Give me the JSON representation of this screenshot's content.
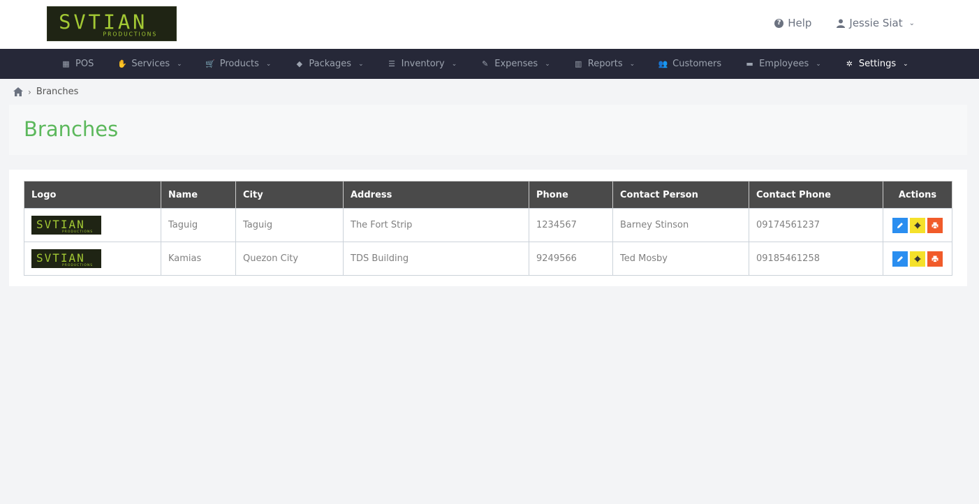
{
  "brand": {
    "logo_text": "SVTIAN",
    "logo_sub": "PRODUCTIONS"
  },
  "header": {
    "help_label": "Help",
    "user_name": "Jessie Siat"
  },
  "nav": {
    "items": [
      {
        "label": "POS",
        "icon": "calculator-icon",
        "caret": ""
      },
      {
        "label": "Services",
        "icon": "hand-icon",
        "caret": "⌄"
      },
      {
        "label": "Products",
        "icon": "cart-icon",
        "caret": "⌄"
      },
      {
        "label": "Packages",
        "icon": "tags-icon",
        "caret": "⌄"
      },
      {
        "label": "Inventory",
        "icon": "list-icon",
        "caret": "⌄"
      },
      {
        "label": "Expenses",
        "icon": "edit-icon",
        "caret": "⌄"
      },
      {
        "label": "Reports",
        "icon": "bar-chart-icon",
        "caret": "⌄"
      },
      {
        "label": "Customers",
        "icon": "users-icon",
        "caret": ""
      },
      {
        "label": "Employees",
        "icon": "briefcase-icon",
        "caret": "⌄"
      },
      {
        "label": "Settings",
        "icon": "gear-icon",
        "caret": "⌄",
        "active": true
      }
    ]
  },
  "breadcrumb": {
    "current": "Branches"
  },
  "page": {
    "title": "Branches"
  },
  "table": {
    "headers": {
      "logo": "Logo",
      "name": "Name",
      "city": "City",
      "address": "Address",
      "phone": "Phone",
      "contact_person": "Contact Person",
      "contact_phone": "Contact Phone",
      "actions": "Actions"
    },
    "rows": [
      {
        "name": "Taguig",
        "city": "Taguig",
        "address": "The Fort Strip",
        "phone": "1234567",
        "contact_person": "Barney Stinson",
        "contact_phone": "09174561237"
      },
      {
        "name": "Kamias",
        "city": "Quezon City",
        "address": "TDS Building",
        "phone": "9249566",
        "contact_person": "Ted Mosby",
        "contact_phone": "09185461258"
      }
    ]
  },
  "colors": {
    "accent_green": "#5cb85c",
    "navbar": "#262838",
    "edit": "#2a8ef0",
    "gear": "#f5e12a",
    "print": "#f15b2a"
  }
}
